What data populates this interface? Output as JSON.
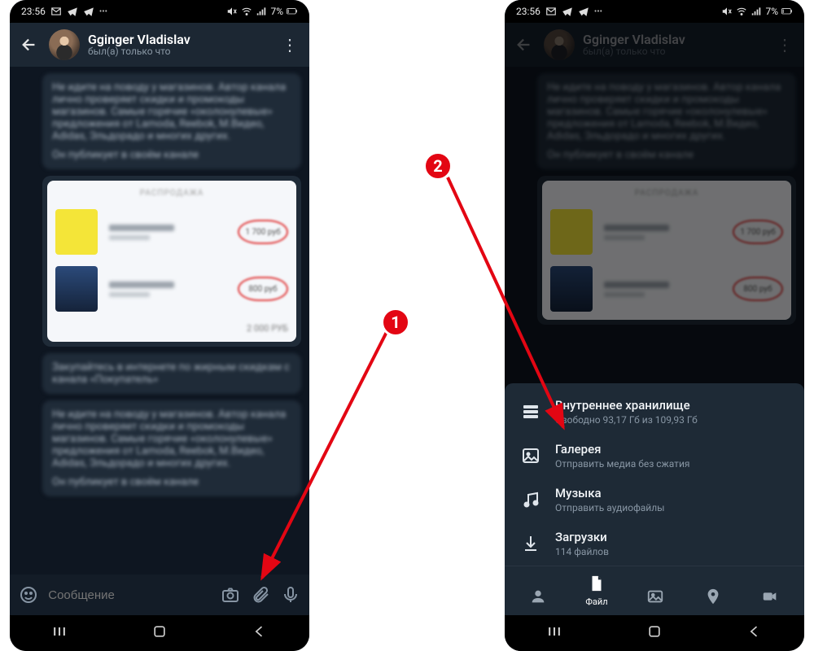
{
  "status": {
    "time": "23:56",
    "battery": "7%"
  },
  "chat": {
    "name": "Gginger Vladislav",
    "subtitle": "был(а) только что"
  },
  "composer": {
    "placeholder": "Сообщение"
  },
  "blur_text": {
    "b1": "Не идите на поводу у магазинов. Автор канала лично проверяет скидки и промокоды магазинов. Самые горячие «околонулевые» предложения от Lamoda, Reebok, М.Видео, Adidas, Эльдорадо и многих других.",
    "b1b": "Он публикует в своём канале",
    "card_head": "РАСПРОДАЖА",
    "p1": "1 700 руб",
    "p2": "800 руб",
    "cfoot": "2 000 РУБ",
    "b2": "Закупайтесь в интернете по жирным скидкам с канала «Покупатель»",
    "b3": "Не идите на поводу у магазинов. Автор канала лично проверяет скидки и промокоды магазинов. Самые горячие «околонулевые» предложения от Lamoda, Reebok, М.Видео, Adidas, Эльдорадо и многих других.",
    "b3b": "Он публикует в своём канале"
  },
  "sheet": {
    "storage_t": "Внутреннее хранилище",
    "storage_s": "Свободно 93,17 Гб из 109,93 Гб",
    "gallery_t": "Галерея",
    "gallery_s": "Отправить медиа без сжатия",
    "music_t": "Музыка",
    "music_s": "Отправить аудиофайлы",
    "downloads_t": "Загрузки",
    "downloads_s": "114 файлов",
    "tab_file": "Файл"
  },
  "annot": {
    "one": "1",
    "two": "2"
  }
}
